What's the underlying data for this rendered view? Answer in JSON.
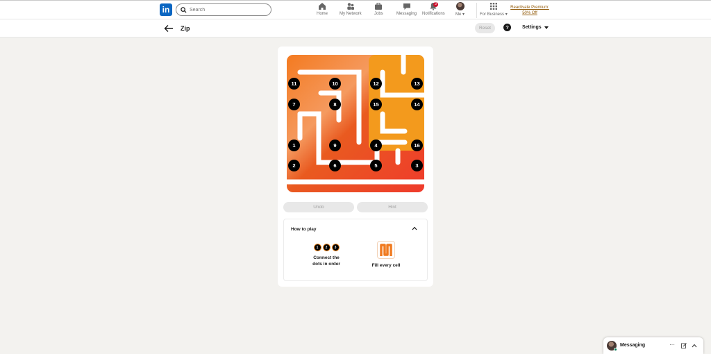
{
  "nav": {
    "logo_text": "in",
    "search_placeholder": "Search",
    "items": [
      {
        "label": "Home",
        "icon": "home-icon"
      },
      {
        "label": "My Network",
        "icon": "network-icon"
      },
      {
        "label": "Jobs",
        "icon": "briefcase-icon"
      },
      {
        "label": "Messaging",
        "icon": "chat-icon"
      },
      {
        "label": "Notifications",
        "icon": "bell-icon",
        "badge": "3"
      },
      {
        "label": "Me",
        "icon": "avatar"
      }
    ],
    "business_label": "For Business",
    "premium_line1": "Reactivate Premium:",
    "premium_line2": "50% Off"
  },
  "game": {
    "title": "Zip",
    "reset_label": "Reset",
    "help_label": "?",
    "settings_label": "Settings",
    "undo_label": "Undo",
    "hint_label": "Hint",
    "nodes": [
      "1",
      "2",
      "3",
      "4",
      "5",
      "6",
      "7",
      "8",
      "9",
      "10",
      "11",
      "12",
      "13",
      "14",
      "15",
      "16"
    ]
  },
  "howto": {
    "title": "How to play",
    "step1_line1": "Connect the",
    "step1_line2": "dots in order",
    "step1_dots": [
      "1",
      "2",
      "3"
    ],
    "step2_label": "Fill every cell"
  },
  "messaging": {
    "label": "Messaging",
    "more": "···"
  },
  "colors": {
    "brand": "#0a66c2",
    "path_start": "#f28c28",
    "path_end": "#ef4a2b",
    "premium": "#915907"
  }
}
